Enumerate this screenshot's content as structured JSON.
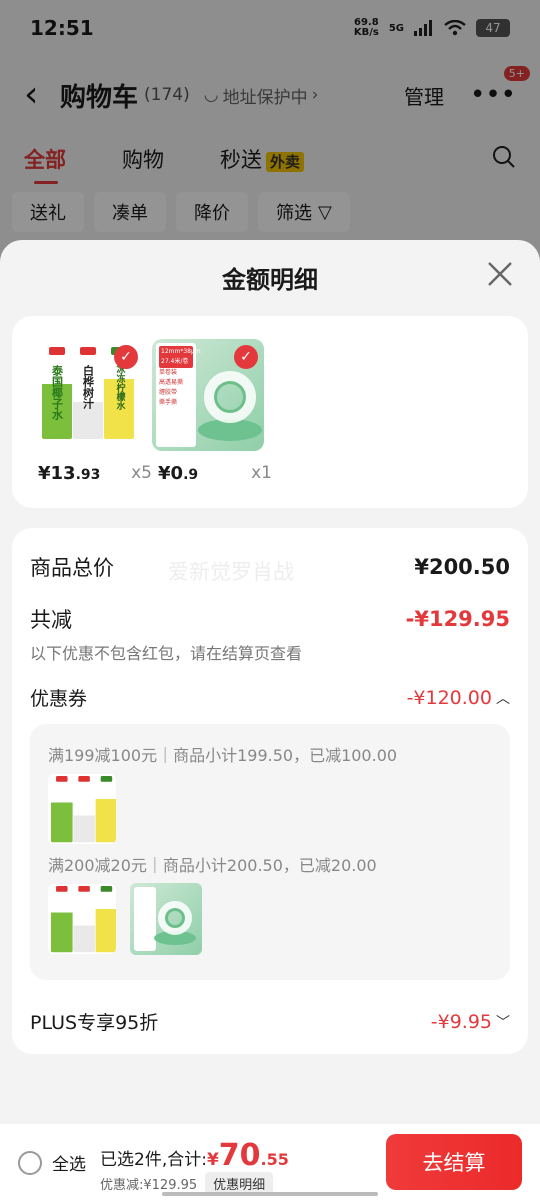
{
  "status": {
    "time": "12:51",
    "speed_value": "69.8",
    "speed_unit": "KB/s",
    "network": "5G",
    "battery": "47"
  },
  "header": {
    "title": "购物车",
    "count": "(174)",
    "addr_protect": "地址保护中",
    "manage": "管理",
    "badge": "5+"
  },
  "tabs": {
    "all": "全部",
    "shopping": "购物",
    "flash": "秒送",
    "takeout": "外卖"
  },
  "filters": [
    "送礼",
    "凑单",
    "降价",
    "筛选"
  ],
  "sheet": {
    "title": "金额明细",
    "watermark": "爱新觉罗肖战"
  },
  "products": [
    {
      "price_int": "¥13",
      "price_dec": ".93",
      "qty": "x5",
      "labels": [
        "泰国椰子水",
        "白桦树汁",
        "冰冻柠檬水"
      ]
    },
    {
      "price_int": "¥0",
      "price_dec": ".9",
      "qty": "x1",
      "labels": [
        "12mm*38μm 27.4米/卷",
        "单卷装",
        "高透易撕",
        "缠胶带",
        "撕手撕"
      ]
    }
  ],
  "summary": {
    "goods_total_label": "商品总价",
    "goods_total": "¥200.50",
    "discount_label": "共减",
    "discount": "-¥129.95",
    "discount_note": "以下优惠不包含红包，请在结算页查看",
    "coupon_label": "优惠券",
    "coupon_value": "-¥120.00",
    "coupons": [
      "满199减100元｜商品小计199.50，已减100.00",
      "满200减20元｜商品小计200.50，已减20.00"
    ],
    "plus_label": "PLUS专享95折",
    "plus_value": "-¥9.95"
  },
  "bottom": {
    "select_all": "全选",
    "selected_text": "已选2件,合计:",
    "currency": "¥",
    "total_int": "70",
    "total_dec": ".55",
    "saved": "优惠减:¥129.95",
    "detail": "优惠明细",
    "checkout": "去结算"
  },
  "colors": {
    "accent": "#e4393c"
  }
}
